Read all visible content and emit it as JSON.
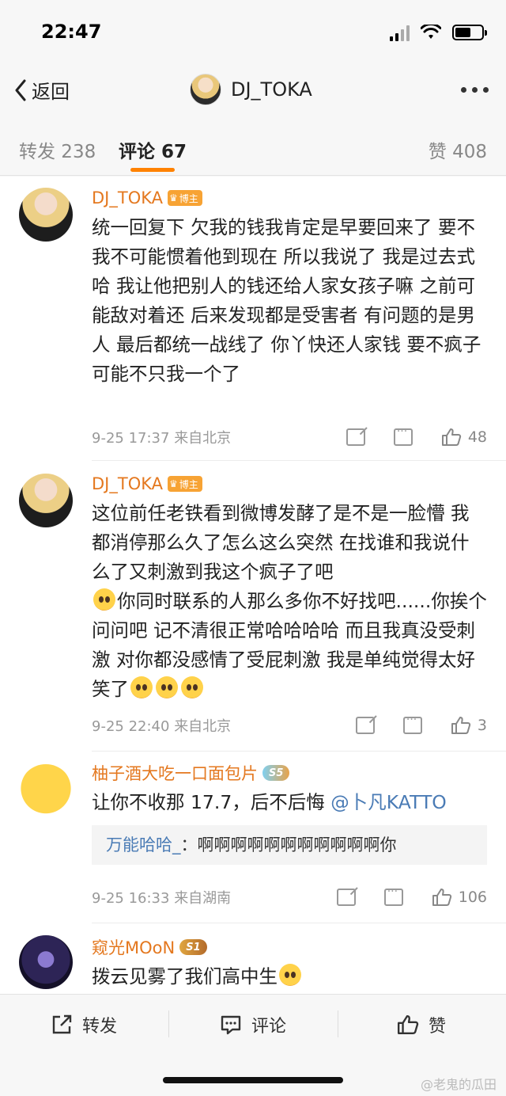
{
  "status_bar": {
    "time": "22:47",
    "battery_level": 0.6
  },
  "nav": {
    "back_label": "返回",
    "title": "DJ_TOKA"
  },
  "tabs": {
    "repost": "转发 238",
    "comments": "评论 67",
    "likes": "赞 408"
  },
  "comments": [
    {
      "name": "DJ_TOKA",
      "badge": "博主",
      "text": "统一回复下 欠我的钱我肯定是早要回来了 要不我不可能惯着他到现在   所以我说了 我是过去式哈 我让他把别人的钱还给人家女孩子嘛 之前可能敌对着还 后来发现都是受害者 有问题的是男人 最后都统一战线了 你丫快还人家钱 要不疯子可能不只我一个了",
      "time": "9-25 17:37",
      "location": "来自北京",
      "likes": "48"
    },
    {
      "name": "DJ_TOKA",
      "badge": "博主",
      "text_1": "这位前任老铁看到微博发酵了是不是一脸懵 我都消停那么久了怎么这么突然  在找谁和我说什么了又刺激到我这个疯子了吧",
      "text_2": "你同时联系的人那么多你不好找吧......你挨个问问吧 记不清很正常哈哈哈哈 而且我真没受刺激 对你都没感情了受屁刺激 我是单纯觉得太好笑了",
      "time": "9-25 22:40",
      "location": "来自北京",
      "likes": "3"
    },
    {
      "name": "柚子酒大吃一口面包片",
      "level": "S5",
      "text": "让你不收那 17.7，后不后悔 ",
      "mention": "@卜凡KATTO",
      "reply_name": "万能哈哈_",
      "reply_text": "：啊啊啊啊啊啊啊啊啊啊啊你",
      "time": "9-25 16:33",
      "location": "来自湖南",
      "likes": "106"
    },
    {
      "name": "窥光MOoN",
      "level": "S1",
      "text": "拨云见雾了我们高中生"
    }
  ],
  "bottom_bar": {
    "repost": "转发",
    "comment": "评论",
    "like": "赞"
  },
  "watermark": "@老鬼的瓜田",
  "colors": {
    "accent": "#ff8200",
    "username": "#e4781f",
    "link": "#4a7bb5"
  }
}
